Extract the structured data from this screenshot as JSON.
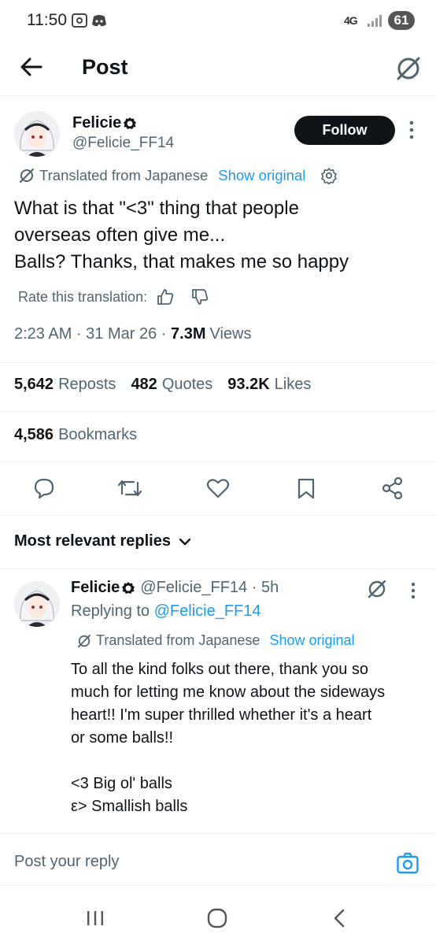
{
  "status_bar": {
    "time": "11:50",
    "network": "4G",
    "battery": "61"
  },
  "app_bar": {
    "title": "Post"
  },
  "post": {
    "author_name": "Felicie",
    "author_handle": "@Felicie_FF14",
    "follow_label": "Follow",
    "translated_label": "Translated from Japanese",
    "show_original": "Show original",
    "text": "What is that \"<3\" thing that people\noverseas often give me...\nBalls? Thanks, that makes me so happy",
    "rate_label": "Rate this translation:",
    "time": "2:23 AM",
    "date": "31 Mar 26",
    "views_count": "7.3M",
    "views_label": "Views",
    "reposts_count": "5,642",
    "reposts_label": "Reposts",
    "quotes_count": "482",
    "quotes_label": "Quotes",
    "likes_count": "93.2K",
    "likes_label": "Likes",
    "bookmarks_count": "4,586",
    "bookmarks_label": "Bookmarks"
  },
  "replies_filter": "Most relevant replies",
  "reply": {
    "author_name": "Felicie",
    "author_handle": "@Felicie_FF14",
    "time": "5h",
    "replying_prefix": "Replying to",
    "replying_handle": "@Felicie_FF14",
    "translated_label": "Translated from Japanese",
    "show_original": "Show original",
    "text": "To all the kind folks out there, thank you so\nmuch for letting me know about the sideways\nheart!! I'm super thrilled whether it's a heart\nor some balls!!\n\n<3  Big ol' balls\nε>  Smallish balls"
  },
  "composer": {
    "placeholder": "Post your reply"
  },
  "colors": {
    "accent": "#1d9bf0",
    "text": "#0f1419",
    "muted": "#536471",
    "divider": "#eff3f4"
  }
}
